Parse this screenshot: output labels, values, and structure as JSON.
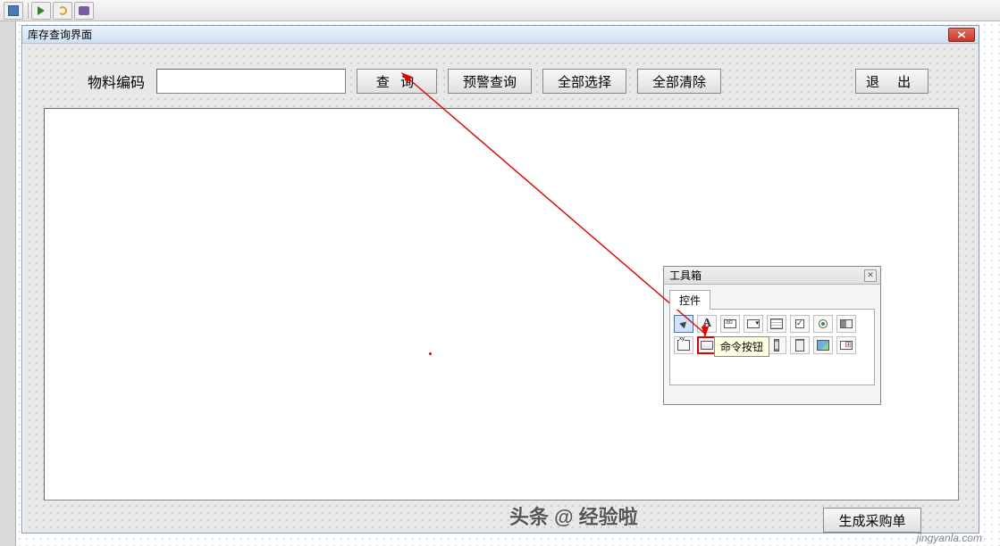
{
  "toolbar_icons": [
    "save",
    "play",
    "reset",
    "debug"
  ],
  "form": {
    "title": "库存查询界面",
    "material_label": "物料编码",
    "material_value": "",
    "buttons": {
      "query": "查  询",
      "alert_query": "预警查询",
      "select_all": "全部选择",
      "clear_all": "全部清除",
      "exit": "退  出",
      "generate": "生成采购单"
    }
  },
  "toolbox": {
    "title": "工具箱",
    "tab": "控件",
    "tooltip": "命令按钮",
    "tools_row1": [
      "pointer",
      "label",
      "textbox",
      "combo",
      "list",
      "check",
      "radio",
      "toggle"
    ],
    "tools_row2": [
      "frame",
      "cmdbtn",
      "tab",
      "multi",
      "scroll",
      "spin",
      "image",
      "ref"
    ],
    "selected": "pointer",
    "highlighted": "cmdbtn"
  },
  "watermark": {
    "line1": "头条 @ 经验啦",
    "line2": "jingyanla.com"
  }
}
